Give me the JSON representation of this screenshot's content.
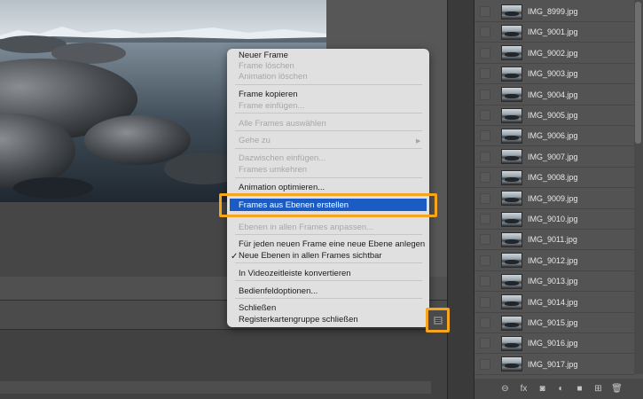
{
  "context_menu": {
    "items": [
      {
        "label": "Neuer Frame",
        "disabled": false
      },
      {
        "label": "Frame löschen",
        "disabled": true
      },
      {
        "label": "Animation löschen",
        "disabled": true
      },
      {
        "label": "Frame kopieren",
        "disabled": false
      },
      {
        "label": "Frame einfügen...",
        "disabled": true
      },
      {
        "label": "Alle Frames auswählen",
        "disabled": true
      },
      {
        "label": "Gehe zu",
        "disabled": true,
        "submenu": true
      },
      {
        "label": "Dazwischen einfügen...",
        "disabled": true
      },
      {
        "label": "Frames umkehren",
        "disabled": true
      },
      {
        "label": "Animation optimieren...",
        "disabled": false
      },
      {
        "label": "Frames aus Ebenen erstellen",
        "disabled": false,
        "highlighted": true
      },
      {
        "label": "Ebenen in allen Frames anpassen...",
        "disabled": true
      },
      {
        "label": "Für jeden neuen Frame eine neue Ebene anlegen",
        "disabled": false
      },
      {
        "label": "Neue Ebenen in allen Frames sichtbar",
        "disabled": false,
        "checked": true
      },
      {
        "label": "In Videozeitleiste konvertieren",
        "disabled": false
      },
      {
        "label": "Bedienfeldoptionen...",
        "disabled": false
      },
      {
        "label": "Schließen",
        "disabled": false
      },
      {
        "label": "Registerkartengruppe schließen",
        "disabled": false
      }
    ],
    "submenu_arrow": "▶",
    "checkmark": "✓",
    "highlight_color": "#1a5cc3"
  },
  "layers_panel": {
    "layers": [
      "IMG_8999.jpg",
      "IMG_9001.jpg",
      "IMG_9002.jpg",
      "IMG_9003.jpg",
      "IMG_9004.jpg",
      "IMG_9005.jpg",
      "IMG_9006.jpg",
      "IMG_9007.jpg",
      "IMG_9008.jpg",
      "IMG_9009.jpg",
      "IMG_9010.jpg",
      "IMG_9011.jpg",
      "IMG_9012.jpg",
      "IMG_9013.jpg",
      "IMG_9014.jpg",
      "IMG_9015.jpg",
      "IMG_9016.jpg",
      "IMG_9017.jpg"
    ],
    "footer_icons": [
      "link-icon",
      "fx-icon",
      "mask-icon",
      "adjustment-icon",
      "folder-icon",
      "new-layer-icon",
      "trash-icon"
    ],
    "footer_glyphs": [
      "⊖",
      "fx",
      "◙",
      "◐",
      "■",
      "⊞",
      "🗑"
    ]
  },
  "panel_menu": {
    "icon": "hamburger-menu-icon"
  },
  "colors": {
    "annotation": "#f6a51d",
    "menu_bg": "#e0e0e0"
  }
}
